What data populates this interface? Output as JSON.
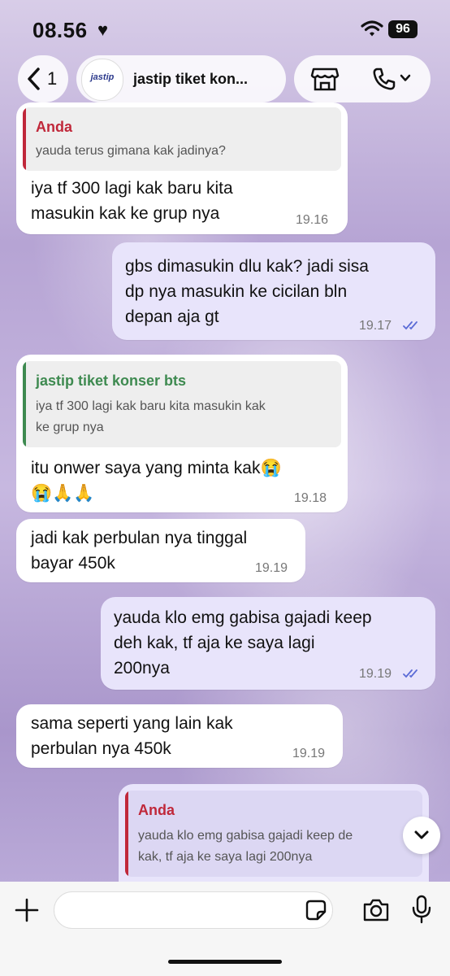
{
  "status_bar": {
    "time": "08.56",
    "heart": "♥",
    "battery": "96"
  },
  "header": {
    "back_count": "1",
    "avatar_text": "jastip",
    "chat_name": "jastip tiket kon..."
  },
  "colors": {
    "quote_me": "#c0283a",
    "quote_other": "#3e8a50",
    "ticks": "#5b6bd6"
  },
  "messages": [
    {
      "quote_name": "Anda",
      "quote_text": "yauda terus gimana kak jadinya?",
      "lines": [
        "iya tf 300 lagi kak baru kita",
        "masukin kak ke grup nya"
      ],
      "time": "19.16"
    },
    {
      "lines": [
        "gbs dimasukin dlu kak? jadi sisa",
        "dp nya masukin ke cicilan bln",
        "depan aja gt"
      ],
      "time": "19.17"
    },
    {
      "quote_name": "jastip tiket konser bts",
      "quote_lines": [
        "iya tf 300 lagi kak baru kita masukin kak",
        "ke grup nya"
      ],
      "lines": [
        "itu onwer saya yang minta kak😭",
        "😭🙏🙏"
      ],
      "time": "19.18"
    },
    {
      "lines": [
        "jadi kak perbulan nya tinggal",
        "bayar 450k"
      ],
      "time": "19.19"
    },
    {
      "lines": [
        "yauda klo emg gabisa gajadi keep",
        "deh kak, tf aja ke saya lagi",
        "200nya"
      ],
      "time": "19.19"
    },
    {
      "lines": [
        "sama seperti yang lain kak",
        "perbulan nya 450k"
      ],
      "time": "19.19"
    },
    {
      "quote_name": "Anda",
      "quote_lines": [
        "yauda klo emg gabisa gajadi keep de",
        "kak, tf aja ke saya lagi 200nya"
      ]
    }
  ],
  "input": {
    "placeholder": ""
  }
}
